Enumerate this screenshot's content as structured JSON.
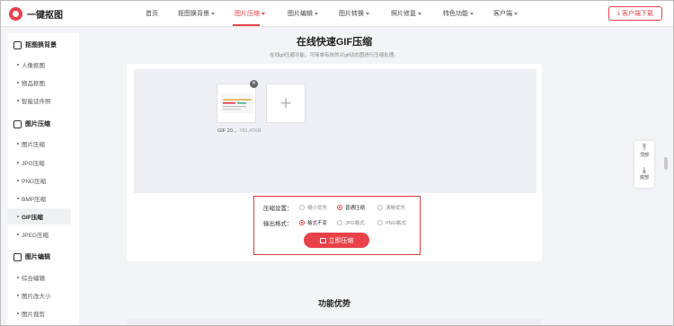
{
  "brand": {
    "name": "一键抠图",
    "accent": "#e8414a"
  },
  "nav": {
    "items": [
      {
        "label": "首页",
        "caret": false
      },
      {
        "label": "抠图换背景",
        "caret": true
      },
      {
        "label": "图片压缩",
        "caret": true,
        "active": true
      },
      {
        "label": "图片编辑",
        "caret": true
      },
      {
        "label": "图片转换",
        "caret": true
      },
      {
        "label": "照片修复",
        "caret": true
      },
      {
        "label": "特色功能",
        "caret": true
      },
      {
        "label": "客户端",
        "caret": true
      }
    ],
    "download_label": "客户端下载"
  },
  "sidebar": {
    "groups": [
      {
        "label": "抠图换背景",
        "icon": "cutout-icon",
        "items": [
          "人像抠图",
          "物品抠图",
          "智能证件照"
        ]
      },
      {
        "label": "图片压缩",
        "icon": "compress-icon",
        "items": [
          "图片压缩",
          "JPG压缩",
          "PNG压缩",
          "BMP压缩",
          "GIF压缩",
          "JPEG压缩"
        ],
        "active": "GIF压缩"
      },
      {
        "label": "图片编辑",
        "icon": "edit-icon",
        "items": [
          "综合编辑",
          "图片改大小",
          "图片裁剪"
        ]
      }
    ]
  },
  "main": {
    "title": "在线快速GIF压缩",
    "subtitle": "在线gif压缩功能，可简单有效的对gif动态图进行压缩处理。",
    "file": {
      "name": "GIF 20...",
      "size": "761.47KB"
    },
    "settings": {
      "compress_label": "压缩设置：",
      "compress_options": [
        {
          "label": "缩小优先",
          "selected": false
        },
        {
          "label": "普通压缩",
          "selected": true
        },
        {
          "label": "清晰优先",
          "selected": false
        }
      ],
      "format_label": "输出格式：",
      "format_options": [
        {
          "label": "格式不变",
          "selected": true
        },
        {
          "label": "JPG格式",
          "selected": false
        },
        {
          "label": "PNG格式",
          "selected": false
        }
      ],
      "action_label": "立即压缩"
    },
    "section2_title": "功能优势"
  },
  "floater": {
    "top_label": "顶部",
    "bottom_label": "底部"
  }
}
